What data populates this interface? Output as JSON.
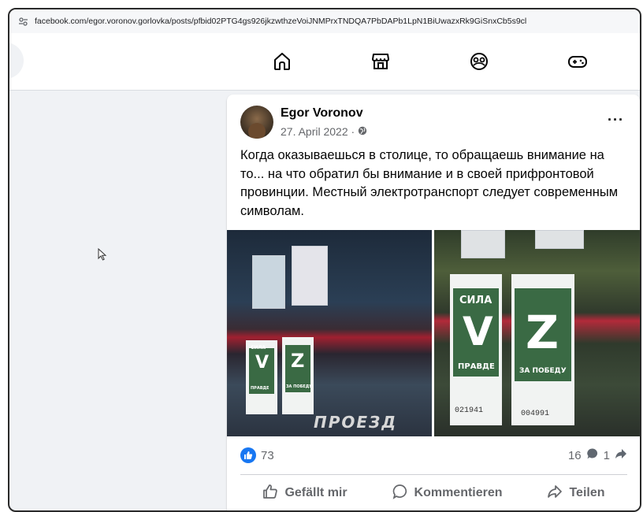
{
  "browser": {
    "url": "facebook.com/egor.voronov.gorlovka/posts/pfbid02PTG4gs926jkzwthzeVoiJNMPrxTNDQA7PbDAPb1LpN1BiUwazxRk9GiSnxCb5s9cl"
  },
  "nav": {
    "icons": [
      "home-icon",
      "marketplace-icon",
      "groups-icon",
      "gaming-icon"
    ]
  },
  "post": {
    "author": "Egor Voronov",
    "date": "27. April 2022 ·",
    "more": "···",
    "text": "Когда оказываешься в столице, то обращаешь внимание на то... на что обратил бы внимание и в своей прифронтовой провинции. Местный электротранспорт следует современным символам.",
    "reactions_count": "73",
    "comments_count": "16",
    "shares_count": "1",
    "actions": {
      "like": "Gefällt mir",
      "comment": "Kommentieren",
      "share": "Teilen"
    }
  },
  "photos": {
    "left": {
      "poster_text_top": "СИЛА",
      "poster_letter_1": "V",
      "poster_letter_2": "Z",
      "poster_caption_1": "ПРАВДЕ",
      "poster_caption_2": "ЗА ПОБЕДУ",
      "glass_text": "ПРОЕЗД"
    },
    "right": {
      "poster_text_top": "СИЛА",
      "poster_letter_1": "V",
      "poster_letter_2": "Z",
      "poster_caption_1": "ПРАВДЕ",
      "poster_caption_2": "ЗА ПОБЕДУ",
      "ticket_1": "021941",
      "ticket_2": "004991"
    }
  },
  "colors": {
    "accent": "#1877f2",
    "text_secondary": "#65676b"
  }
}
